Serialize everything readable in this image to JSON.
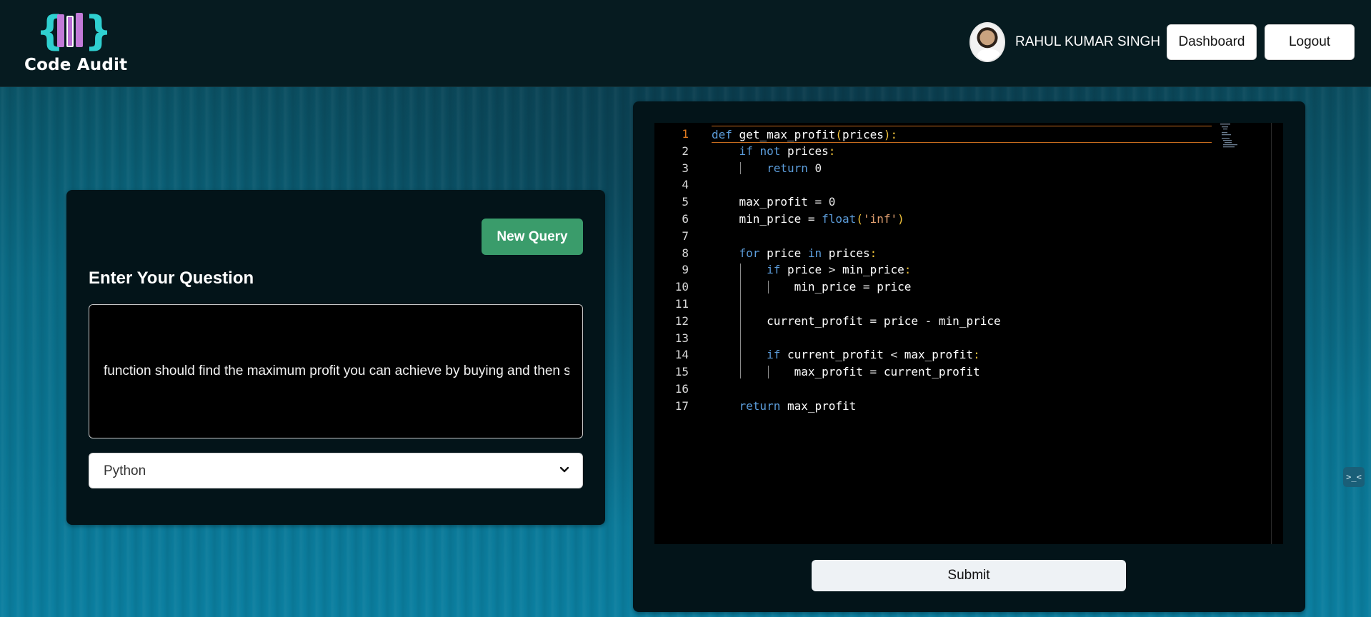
{
  "header": {
    "logo_text": "Code Audit",
    "user_name": "RAHUL KUMAR SINGH",
    "dashboard_label": "Dashboard",
    "logout_label": "Logout"
  },
  "query": {
    "new_query_label": "New Query",
    "title": "Enter Your Question",
    "question_text": "function should find the maximum profit you can achieve by buying and then selling",
    "language_selected": "Python"
  },
  "editor": {
    "active_line": 1,
    "lines": [
      {
        "num": "1",
        "text": "def get_max_profit(prices):"
      },
      {
        "num": "2",
        "text": "    if not prices:"
      },
      {
        "num": "3",
        "text": "        return 0"
      },
      {
        "num": "4",
        "text": ""
      },
      {
        "num": "5",
        "text": "    max_profit = 0"
      },
      {
        "num": "6",
        "text": "    min_price = float('inf')"
      },
      {
        "num": "7",
        "text": ""
      },
      {
        "num": "8",
        "text": "    for price in prices:"
      },
      {
        "num": "9",
        "text": "        if price > min_price:"
      },
      {
        "num": "10",
        "text": "            min_price = price"
      },
      {
        "num": "11",
        "text": ""
      },
      {
        "num": "12",
        "text": "        current_profit = price - min_price"
      },
      {
        "num": "13",
        "text": ""
      },
      {
        "num": "14",
        "text": "        if current_profit < max_profit:"
      },
      {
        "num": "15",
        "text": "            max_profit = current_profit"
      },
      {
        "num": "16",
        "text": ""
      },
      {
        "num": "17",
        "text": "    return max_profit"
      }
    ]
  },
  "submit_label": "Submit",
  "side_widget_label": ">_<",
  "colors": {
    "header_bg": "#061b20",
    "card_bg": "#031419",
    "new_query_green": "#3a9c6b",
    "active_line_orange": "#e07a1f",
    "keyword_blue": "#5c9ddb"
  }
}
